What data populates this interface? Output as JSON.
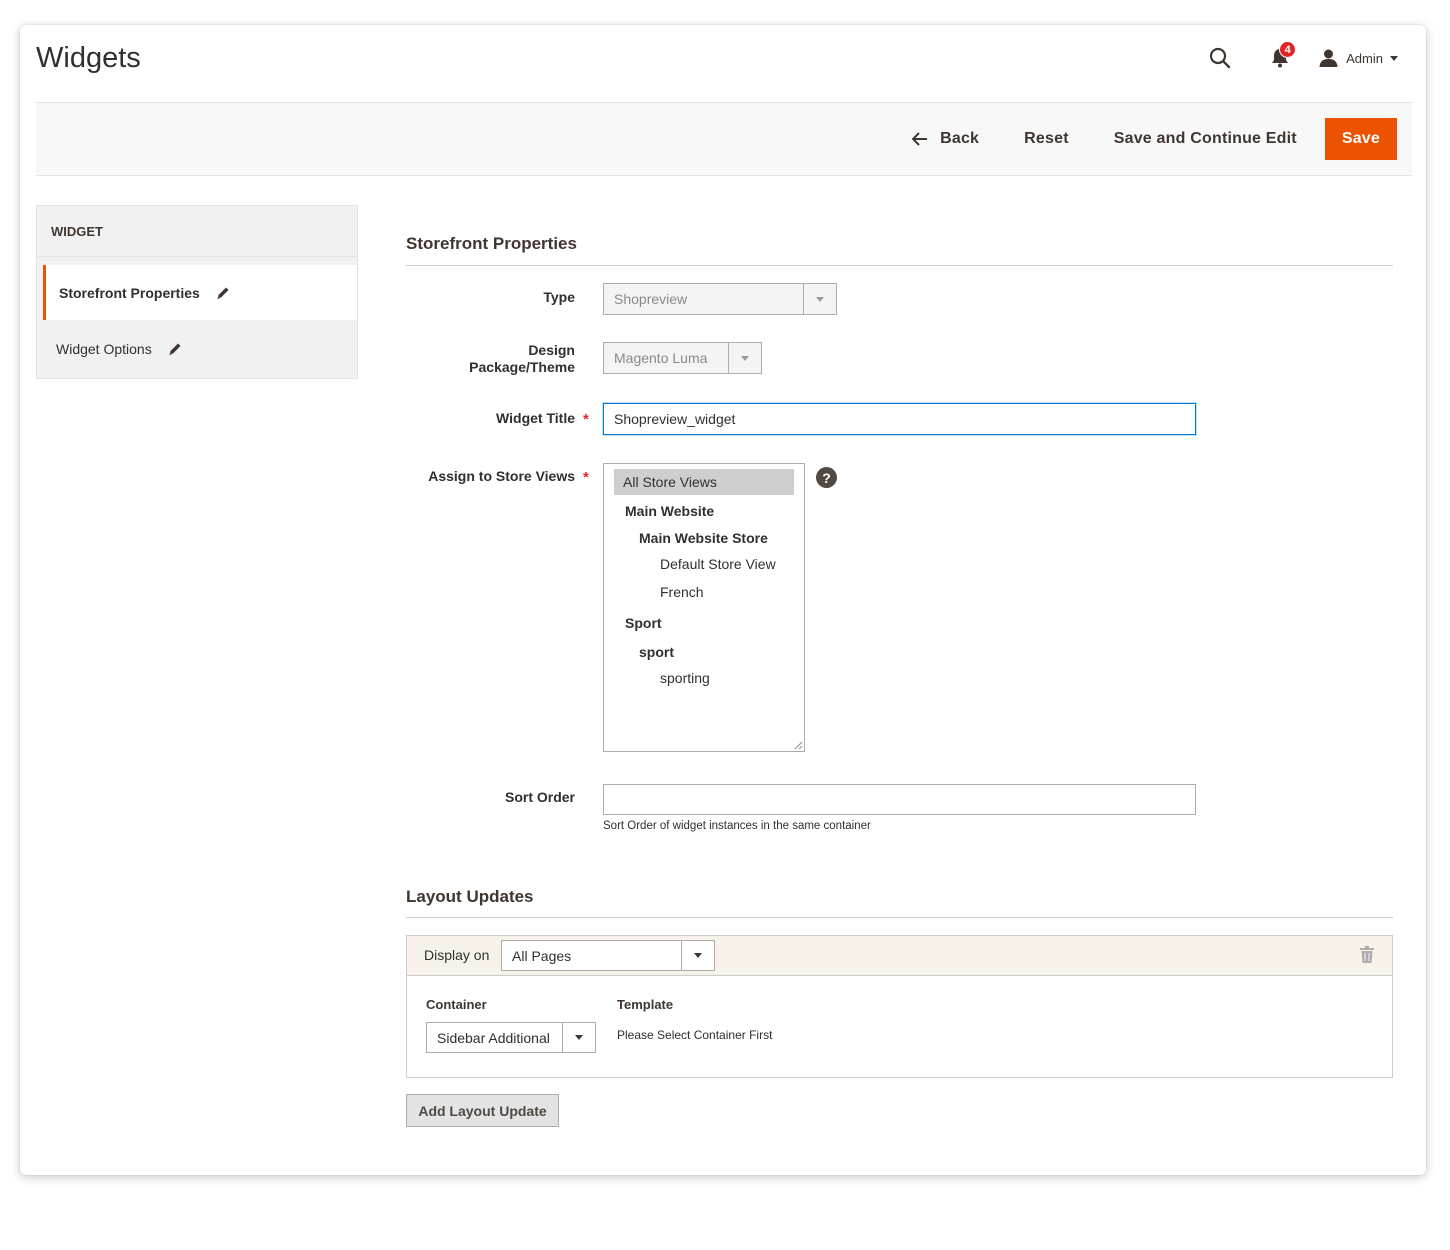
{
  "header": {
    "page_title": "Widgets",
    "notification_count": "4",
    "user_name": "Admin"
  },
  "toolbar": {
    "back_label": "Back",
    "reset_label": "Reset",
    "save_continue_label": "Save and Continue Edit",
    "save_label": "Save"
  },
  "sidebar": {
    "title": "WIDGET",
    "items": [
      {
        "label": "Storefront Properties",
        "active": true
      },
      {
        "label": "Widget Options",
        "active": false
      }
    ]
  },
  "storefront": {
    "section_title": "Storefront Properties",
    "type": {
      "label": "Type",
      "value": "Shopreview"
    },
    "theme": {
      "label_line1": "Design",
      "label_line2": "Package/Theme",
      "value": "Magento Luma"
    },
    "widget_title": {
      "label": "Widget Title",
      "value": "Shopreview_widget"
    },
    "store_views": {
      "label": "Assign to Store Views",
      "options": [
        {
          "label": "All Store Views",
          "level": 0,
          "selected": true
        },
        {
          "label": "Main Website",
          "level": 1
        },
        {
          "label": "Main Website Store",
          "level": 2
        },
        {
          "label": "Default Store View",
          "level": 3
        },
        {
          "label": "French",
          "level": 3
        },
        {
          "label": "Sport",
          "level": 1
        },
        {
          "label": "sport",
          "level": 2
        },
        {
          "label": "sporting",
          "level": 3
        }
      ]
    },
    "sort_order": {
      "label": "Sort Order",
      "value": "",
      "note": "Sort Order of widget instances in the same container"
    }
  },
  "layout_updates": {
    "section_title": "Layout Updates",
    "display_on_label": "Display on",
    "display_on_value": "All Pages",
    "container_label": "Container",
    "container_value": "Sidebar Additional",
    "template_label": "Template",
    "template_note": "Please Select Container First",
    "add_button_label": "Add Layout Update"
  },
  "colors": {
    "accent": "#eb5202",
    "focus": "#007bdb",
    "required": "#e22626"
  }
}
